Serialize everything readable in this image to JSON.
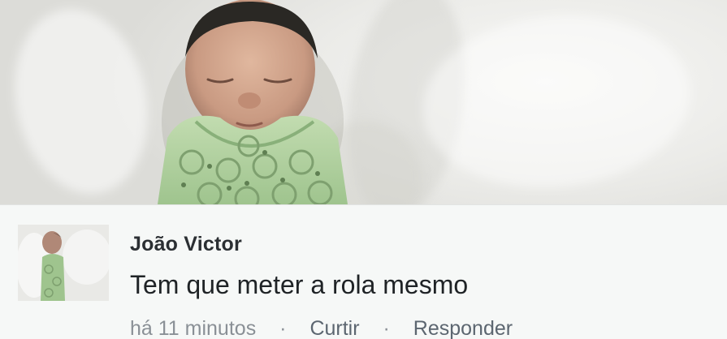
{
  "post": {
    "image_icon": "newborn-baby-photo"
  },
  "comment": {
    "author": "João Victor",
    "text": "Tem que meter a rola mesmo",
    "timestamp": "há 11 minutos",
    "separator": "·",
    "actions": {
      "like_label": "Curtir",
      "reply_label": "Responder"
    },
    "colors": {
      "author": "#2b2f33",
      "text": "#1f2326",
      "meta": "#8a9096",
      "background": "#f6f8f7"
    }
  }
}
